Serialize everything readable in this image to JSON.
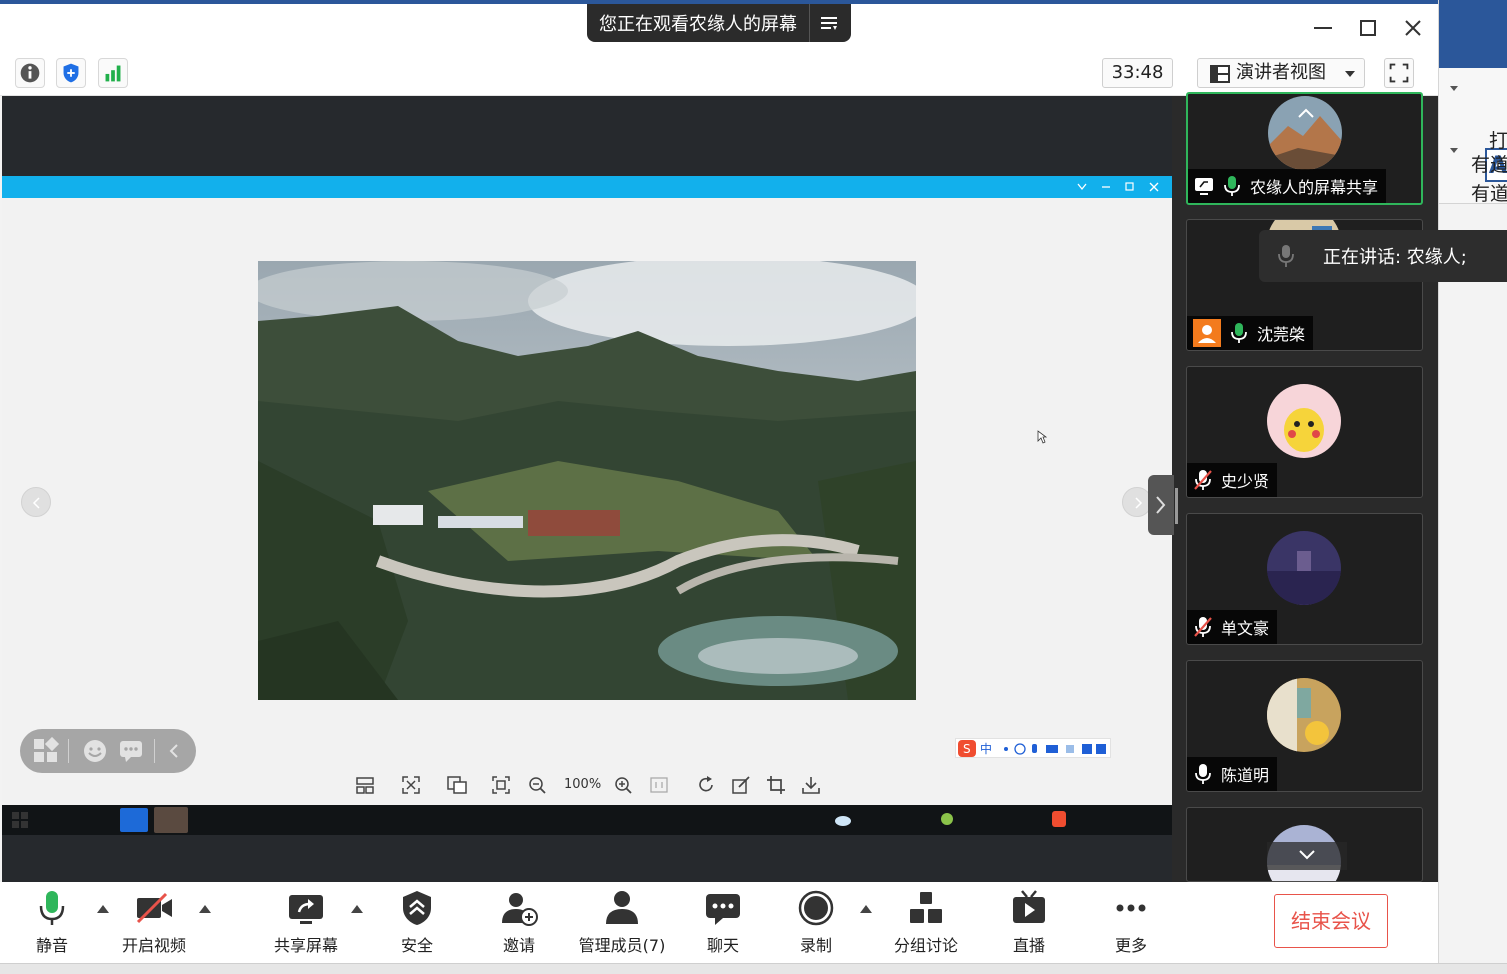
{
  "background_window": {
    "ribbon_texts": [
      "打",
      "有道",
      "有道"
    ],
    "word_icon_letter": "A"
  },
  "title_bar": {
    "share_status": "您正在观看农缘人的屏幕"
  },
  "info_bar": {
    "timer": "33:48",
    "view_mode_label": "演讲者视图"
  },
  "shared_screen": {
    "zoom_level": "100%",
    "ime_label": "中"
  },
  "gallery": {
    "speaking_label": "正在讲话: 农缘人;",
    "participants": [
      {
        "name": "农缘人的屏幕共享",
        "mic": "on",
        "avatar_icon": "mountain-avatar-icon",
        "active": true
      },
      {
        "name": "沈莞棨",
        "mic": "on",
        "avatar_icon": "user-avatar-icon",
        "active": false
      },
      {
        "name": "史少贤",
        "mic": "muted",
        "avatar_icon": "pikachu-avatar-icon",
        "active": false
      },
      {
        "name": "单文豪",
        "mic": "muted",
        "avatar_icon": "street-avatar-icon",
        "active": false
      },
      {
        "name": "陈道明",
        "mic": "on",
        "avatar_icon": "room-avatar-icon",
        "active": false
      }
    ]
  },
  "toolbar": {
    "mute_label": "静音",
    "video_label": "开启视频",
    "share_label": "共享屏幕",
    "security_label": "安全",
    "invite_label": "邀请",
    "participants_label": "管理成员(7)",
    "chat_label": "聊天",
    "record_label": "录制",
    "breakout_label": "分组讨论",
    "live_label": "直播",
    "more_label": "更多",
    "end_label": "结束会议"
  },
  "colors": {
    "accent_green": "#2fb65b",
    "viewer_blue": "#12b0ec",
    "end_red": "#e8534a",
    "word_blue": "#2b579a"
  }
}
